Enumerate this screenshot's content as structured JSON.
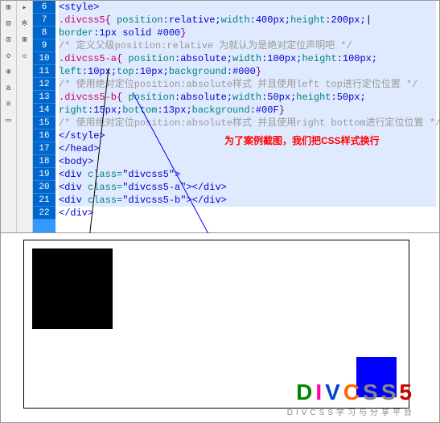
{
  "lines": {
    "start": 6,
    "end": 22
  },
  "code": {
    "l6": {
      "tag": "<style>"
    },
    "l7": {
      "sel": ".divcss5",
      "br1": "{ ",
      "p1": "position",
      "v1": ":relative;",
      "p2": "width",
      "v2": ":400px;",
      "p3": "height",
      "v3": ":200px;"
    },
    "l8": {
      "p1": "border",
      "v1": ":1px solid #000",
      "br2": "}"
    },
    "l9": {
      "comment": "/* 定义父级position:relative 为就认为是绝对定位声明吧 */"
    },
    "l10": {
      "sel": ".divcss5-a",
      "br1": "{ ",
      "p1": "position",
      "v1": ":absolute;",
      "p2": "width",
      "v2": ":100px;",
      "p3": "height",
      "v3": ":100px;"
    },
    "l11": {
      "p1": "left",
      "v1": ":10px;",
      "p2": "top",
      "v2": ":10px;",
      "p3": "background",
      "v3": ":#000",
      "br2": "}"
    },
    "l12": {
      "comment": "/* 使用绝对定位position:absolute样式 并且使用left top进行定位位置 */"
    },
    "l13": {
      "sel": ".divcss5-b",
      "br1": "{ ",
      "p1": "position",
      "v1": ":absolute;",
      "p2": "width",
      "v2": ":50px;",
      "p3": "height",
      "v3": ":50px;"
    },
    "l14": {
      "p1": "right",
      "v1": ":15px;",
      "p2": "bottom",
      "v2": ":13px;",
      "p3": "background",
      "v3": ":#00F",
      "br2": "}"
    },
    "l15": {
      "comment": "/* 使用绝对定位position:absolute样式 并且使用right bottom进行定位位置 */"
    },
    "l16": {
      "tag": "</style>"
    },
    "l17": {
      "tag": "</head>"
    },
    "l18": {
      "tag": "<body>"
    },
    "l19": {
      "tag1": "<div ",
      "attr": "class=",
      "val": "\"divcss5\"",
      "tag2": ">"
    },
    "l20": {
      "tag1": "    <div ",
      "attr": "class=",
      "val": "\"divcss5-a\"",
      "tag2": "></div>"
    },
    "l21": {
      "tag1": "    <div ",
      "attr": "class=",
      "val": "\"divcss5-b\"",
      "tag2": "></div>"
    },
    "l22": {
      "tag": "</div>"
    }
  },
  "annotation": "为了案例截图，我们把CSS样式换行",
  "watermark": {
    "brand": {
      "d": "D",
      "i": "I",
      "v": "V",
      "c": "C",
      "s1": "S",
      "s2": "S",
      "n5": "5"
    },
    "tagline": "DIVCSS学习与分享平台"
  }
}
